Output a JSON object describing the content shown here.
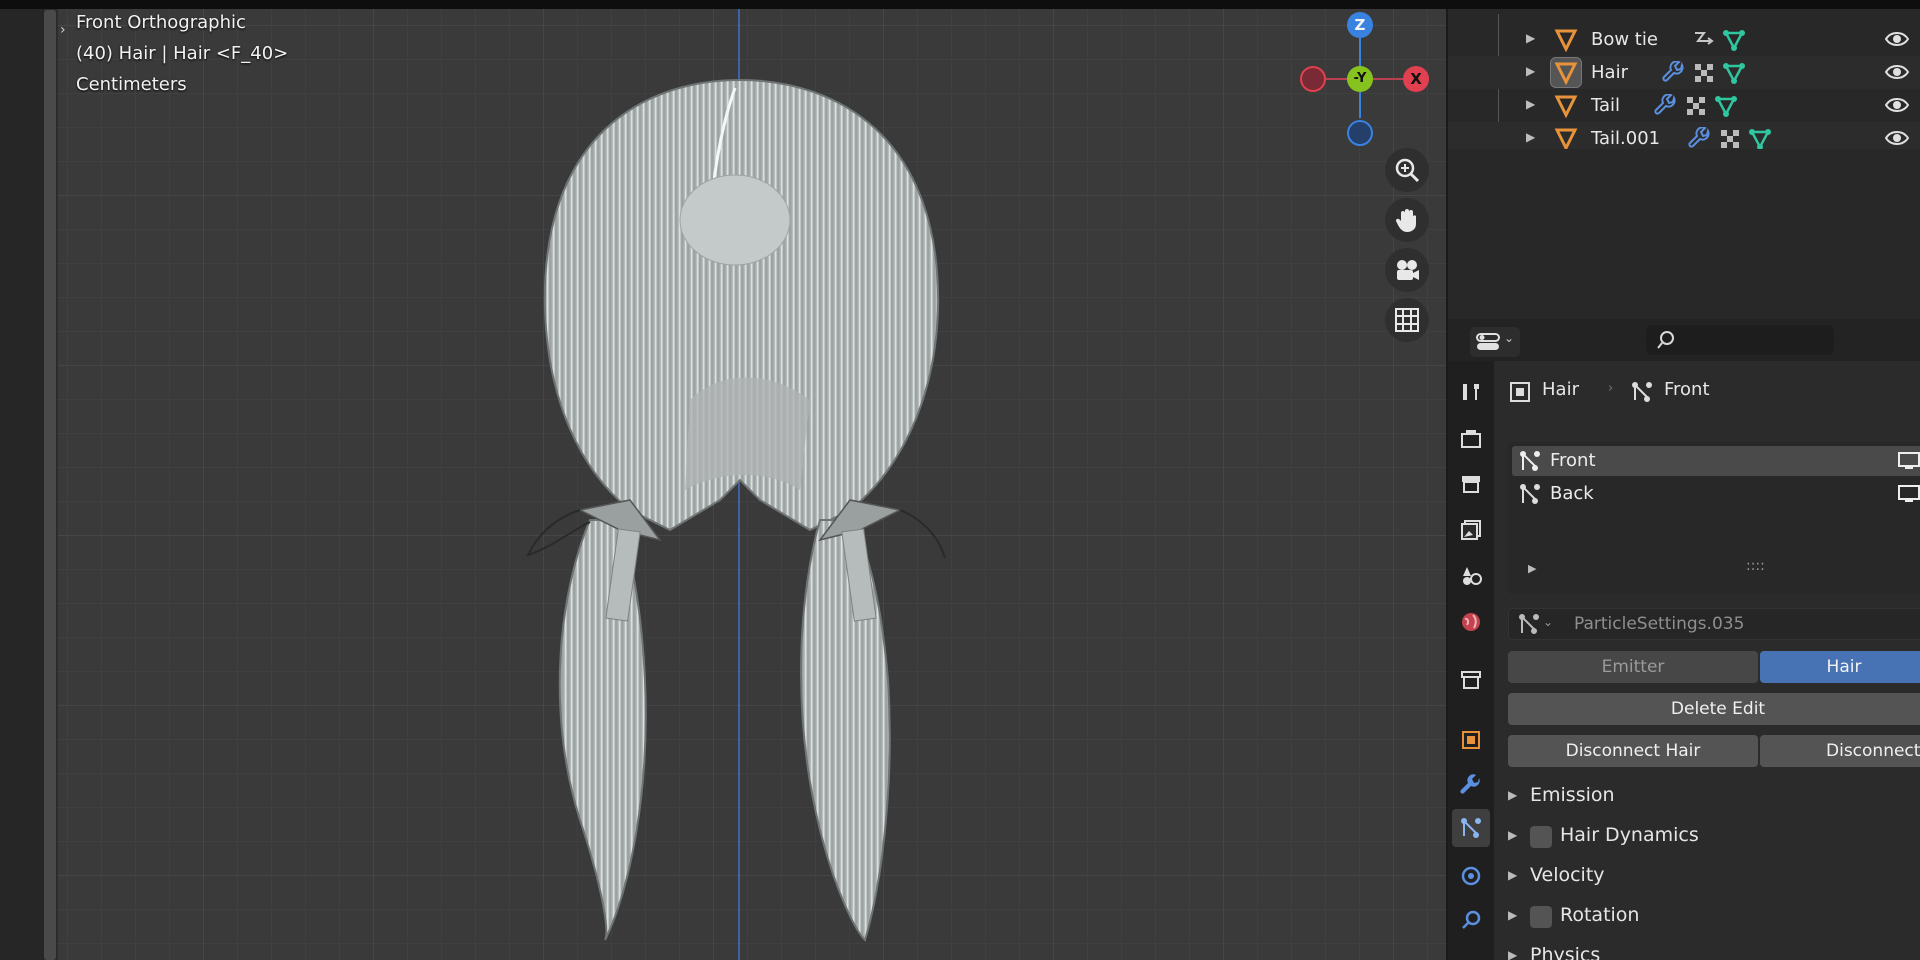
{
  "viewport": {
    "view_name": "Front Orthographic",
    "object_info": "(40) Hair | Hair <F_40>",
    "units": "Centimeters",
    "gizmo": {
      "z": "Z",
      "neg_y": "-Y",
      "x": "X"
    },
    "nav_icons": [
      "zoom-icon",
      "hand-pan-icon",
      "camera-icon",
      "grid-icon"
    ]
  },
  "outliner": {
    "items": [
      {
        "label": "Bow tie",
        "icons": [
          "curve-icon",
          "vertex-group-icon"
        ]
      },
      {
        "label": "Hair",
        "icons": [
          "wrench-icon",
          "checker-icon",
          "vertex-group-icon"
        ]
      },
      {
        "label": "Tail",
        "icons": [
          "wrench-icon",
          "checker-icon",
          "vertex-group-icon"
        ]
      },
      {
        "label": "Tail.001",
        "icons": [
          "wrench-icon",
          "checker-icon",
          "vertex-group-icon"
        ]
      }
    ]
  },
  "properties": {
    "breadcrumb": {
      "object": "Hair",
      "system": "Front"
    },
    "particle_systems": [
      {
        "label": "Front",
        "selected": true
      },
      {
        "label": "Back",
        "selected": false
      }
    ],
    "list_handle": "::::",
    "settings_name": "ParticleSettings.035",
    "type_options": {
      "emitter": "Emitter",
      "hair": "Hair",
      "selected": "Hair"
    },
    "buttons": {
      "delete_edit": "Delete Edit",
      "disconnect_hair": "Disconnect Hair",
      "disconnect_all": "Disconnect"
    },
    "panels": [
      {
        "label": "Emission",
        "checkbox": false
      },
      {
        "label": "Hair Dynamics",
        "checkbox": true
      },
      {
        "label": "Velocity",
        "checkbox": false
      },
      {
        "label": "Rotation",
        "checkbox": true
      },
      {
        "label": "Physics",
        "checkbox": false
      }
    ]
  },
  "colors": {
    "accent_blue": "#4772b3",
    "orange": "#e8923a",
    "teal": "#2fc7a0",
    "axis_x": "#e0404f",
    "axis_y": "#86c31f",
    "axis_z": "#3a82e0"
  }
}
